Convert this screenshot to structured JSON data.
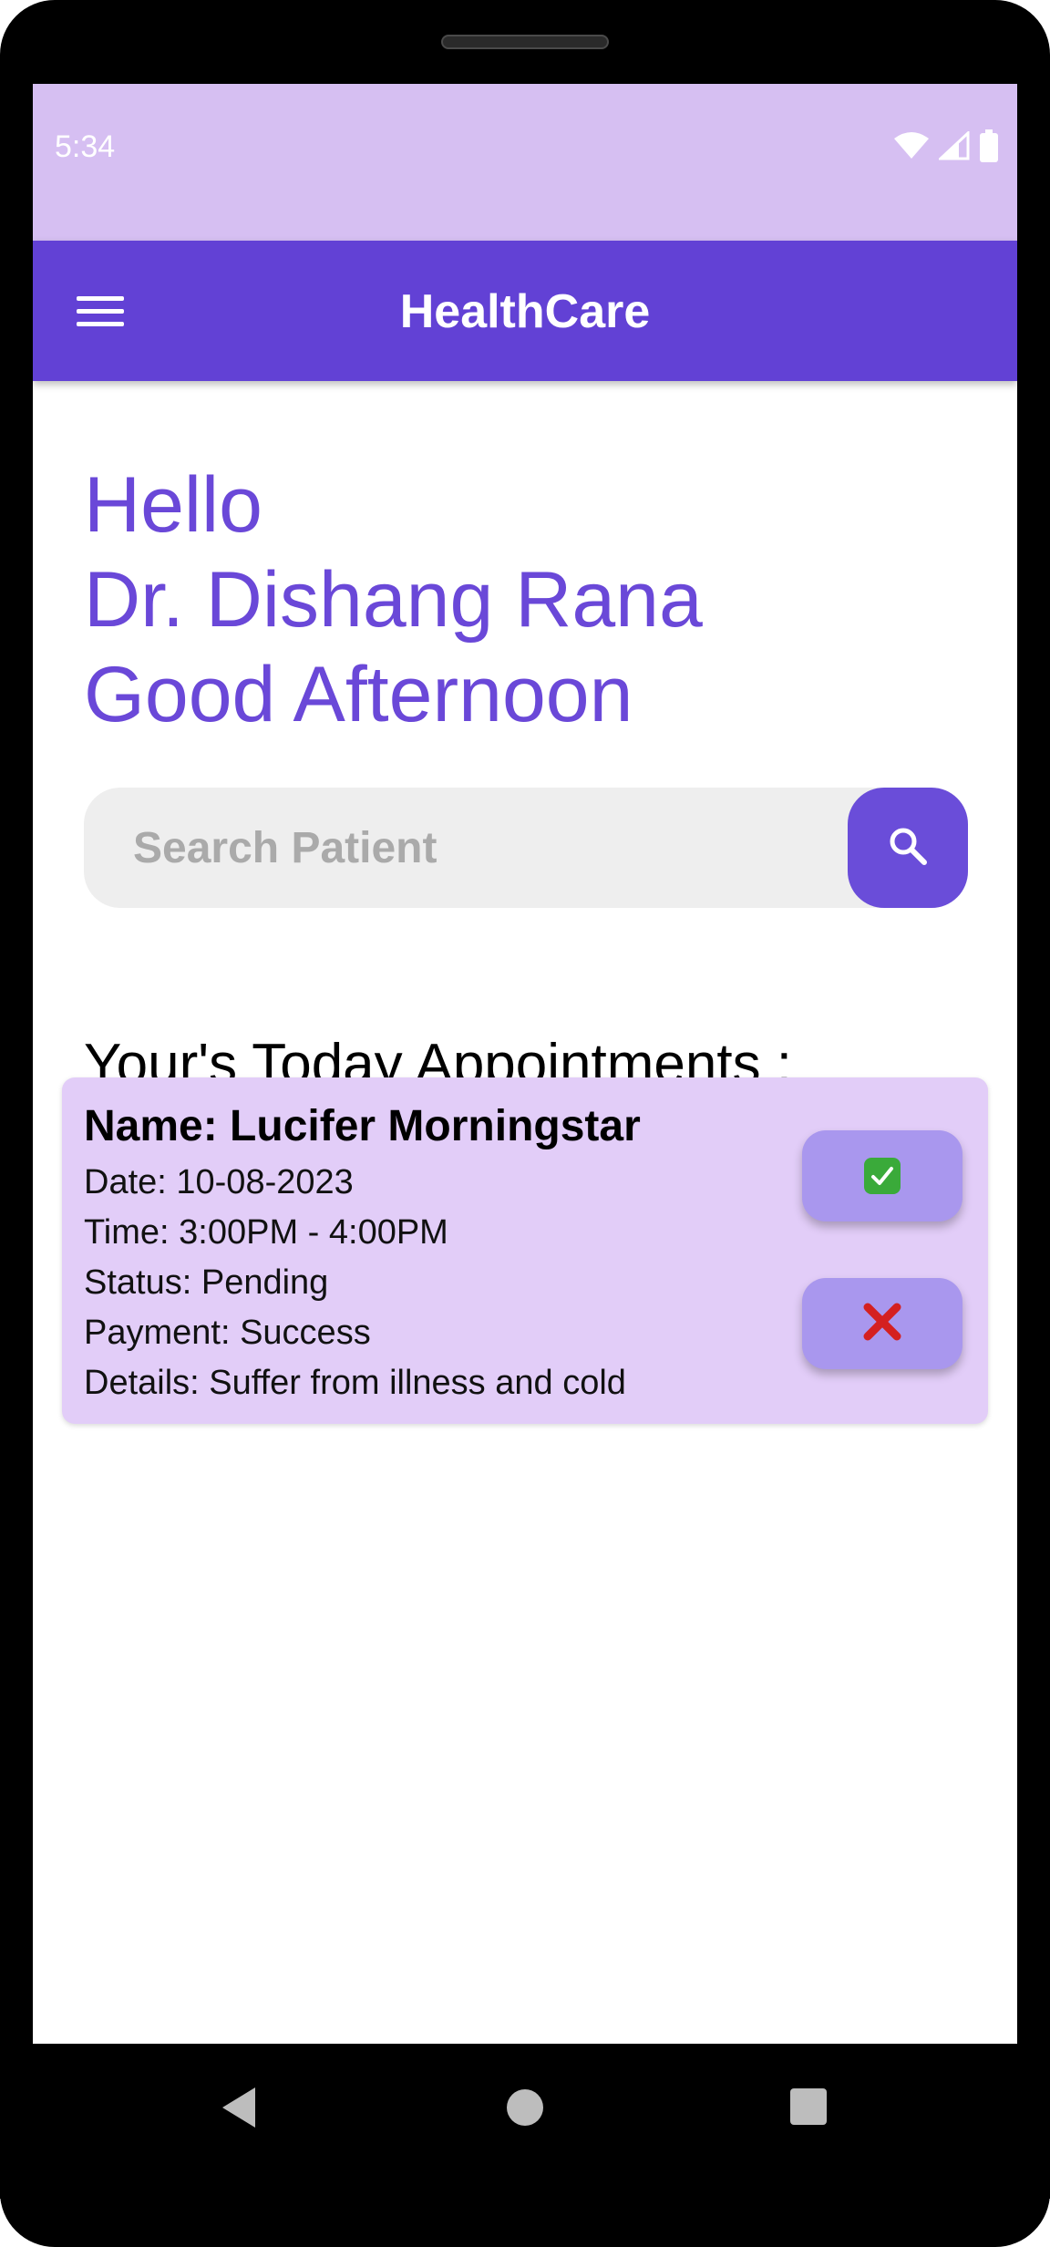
{
  "status_bar": {
    "time": "5:34",
    "icons": [
      "wifi-icon",
      "cellular-icon",
      "battery-icon"
    ]
  },
  "app_bar": {
    "title": "HealthCare",
    "menu_icon": "menu-icon"
  },
  "greeting": {
    "line1": "Hello",
    "line2": "Dr. Dishang Rana",
    "line3": "Good Afternoon"
  },
  "search": {
    "placeholder": "Search Patient",
    "icon": "search-icon"
  },
  "appointments": {
    "heading": "Your's Today Appointments :",
    "items": [
      {
        "name": "Name: Lucifer Morningstar",
        "date": "Date: 10-08-2023",
        "time": "Time: 3:00PM - 4:00PM",
        "status": "Status: Pending",
        "payment": "Payment: Success",
        "details": "Details: Suffer from illness and cold",
        "accept_icon": "check-mark-icon",
        "reject_icon": "cross-mark-icon"
      }
    ]
  },
  "nav_bar": {
    "icons": [
      "back-icon",
      "home-icon",
      "recents-icon"
    ]
  },
  "colors": {
    "primary": "#6241d5",
    "status_bar": "#d6bff2",
    "accent_text": "#6a48d8",
    "card_background": "#e2cdf8",
    "card_button": "#a997ee",
    "search_background": "#eeeeee"
  }
}
